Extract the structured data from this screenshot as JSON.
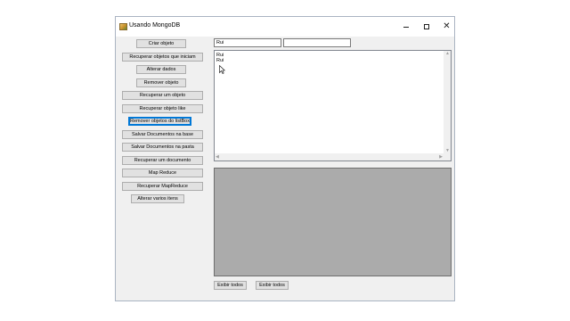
{
  "window": {
    "title": "Usando MongoDB",
    "controls": {
      "minimize": "—",
      "maximize": "☐",
      "close": "✕"
    }
  },
  "buttons": [
    {
      "label": "Criar objeto"
    },
    {
      "label": "Recuperar objetos que iniciam"
    },
    {
      "label": "Alterar dados"
    },
    {
      "label": "Remover objeto"
    },
    {
      "label": "Recuperar um objeto"
    },
    {
      "label": "Recuperar objeto like"
    },
    {
      "label": "Remover objetos do listBox"
    },
    {
      "label": "Salvar Documentos na base"
    },
    {
      "label": "Salvar Documentos na pasta"
    },
    {
      "label": "Recuperar um documento"
    },
    {
      "label": "Map Reduce"
    },
    {
      "label": "Recuperar MapReduce"
    },
    {
      "label": "Alterar varios itens"
    }
  ],
  "inputs": {
    "text1": {
      "value": "Rui"
    },
    "text2": {
      "value": ""
    }
  },
  "listbox": {
    "items": [
      "Rui",
      "Rui"
    ]
  },
  "bottom_buttons": [
    {
      "label": "Exibir todos"
    },
    {
      "label": "Exibir todos"
    }
  ]
}
